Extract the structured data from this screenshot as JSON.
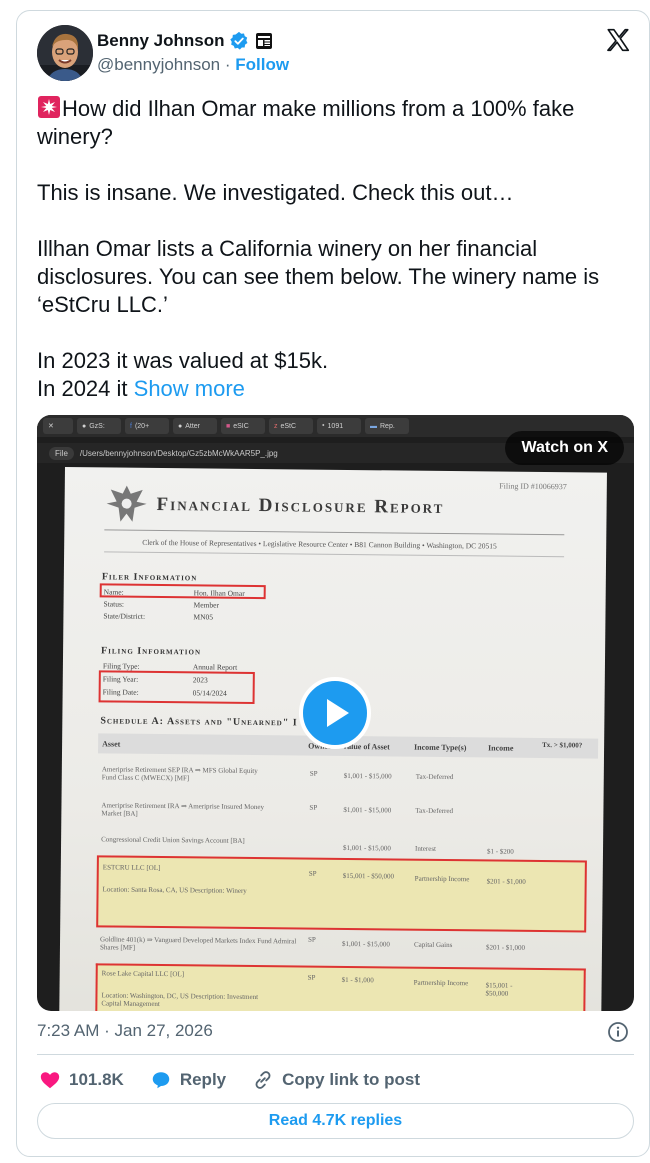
{
  "author": {
    "display_name": "Benny Johnson",
    "handle": "@bennyjohnson",
    "separator": " · ",
    "follow_label": "Follow"
  },
  "tweet": {
    "line1": "How did Ilhan Omar make millions from a 100% fake winery?",
    "para2": "This is insane. We investigated. Check this out…",
    "para3": "Illhan Omar lists a California winery on her financial disclosures. You can see them below. The winery name is ‘eStCru LLC.’",
    "para4a": "In 2023 it was valued at $15k.",
    "para4b": "In 2024 it ",
    "show_more": "Show more",
    "siren_icon": "rotating-light-icon"
  },
  "media": {
    "watch_label": "Watch on X",
    "browser_tabs": [
      "GzS:",
      "(20+",
      "Atter",
      "eSIC",
      "eStC",
      "1091",
      "Rep."
    ],
    "file_pill": "File",
    "url": "/Users/bennyjohnson/Desktop/Gz5zbMcWkAAR5P_.jpg",
    "document": {
      "filing_id": "Filing ID #10066937",
      "title": "Financial Disclosure Report",
      "clerk_line": "Clerk of the House of Representatives • Legislative Resource Center • B81 Cannon Building • Washington, DC 20515",
      "filer_heading": "Filer Information",
      "filer": [
        {
          "k": "Name:",
          "v": "Hon. Ilhan Omar"
        },
        {
          "k": "Status:",
          "v": "Member"
        },
        {
          "k": "State/District:",
          "v": "MN05"
        }
      ],
      "filing_heading": "Filing Information",
      "filing": [
        {
          "k": "Filing Type:",
          "v": "Annual Report"
        },
        {
          "k": "Filing Year:",
          "v": "2023"
        },
        {
          "k": "Filing Date:",
          "v": "05/14/2024"
        }
      ],
      "schedule_heading": "Schedule A: Assets and \"Unearned\" I",
      "columns": [
        "Asset",
        "Owner",
        "Value of Asset",
        "Income Type(s)",
        "Income",
        "Tx. > $1,000?"
      ],
      "rows": [
        {
          "asset": "Ameriprise Retirement SEP IRA ⇒ MFS Global Equity Fund Class C (MWECX) [MF]",
          "owner": "SP",
          "value": "$1,001 - $15,000",
          "type": "Tax-Deferred",
          "income": ""
        },
        {
          "asset": "Ameriprise Retirement IRA ⇒ Ameriprise Insured Money Market [BA]",
          "owner": "SP",
          "value": "$1,001 - $15,000",
          "type": "Tax-Deferred",
          "income": ""
        },
        {
          "asset": "Congressional Credit Union Savings Account [BA]",
          "owner": "",
          "value": "$1,001 - $15,000",
          "type": "Interest",
          "income": "$1 - $200"
        },
        {
          "asset": "ESTCRU LLC [OL]",
          "sub": "Location: Santa Rosa, CA, US  Description: Winery",
          "owner": "SP",
          "value": "$15,001 - $50,000",
          "type": "Partnership Income",
          "income": "$201 - $1,000"
        },
        {
          "asset": "Goldline 401(k) ⇒ Vanguard Developed Markets Index Fund Admiral Shares [MF]",
          "owner": "SP",
          "value": "$1,001 - $15,000",
          "type": "Capital Gains",
          "income": "$201 - $1,000"
        },
        {
          "asset": "Rose Lake Capital LLC [OL]",
          "sub": "Location: Washington, DC, US  Description: Investment Capital Management",
          "owner": "SP",
          "value": "$1 - $1,000",
          "type": "Partnership Income",
          "income": "$15,001 - $50,000"
        }
      ]
    }
  },
  "meta": {
    "time": "7:23 AM",
    "separator": " · ",
    "date": "Jan 27, 2026"
  },
  "actions": {
    "likes": "101.8K",
    "reply_label": "Reply",
    "copy_label": "Copy link to post"
  },
  "read_replies": "Read 4.7K replies",
  "colors": {
    "accent": "#1d9bf0",
    "like": "#f91880",
    "text": "#0f1419",
    "muted": "#536471",
    "border": "#cfd9de"
  }
}
